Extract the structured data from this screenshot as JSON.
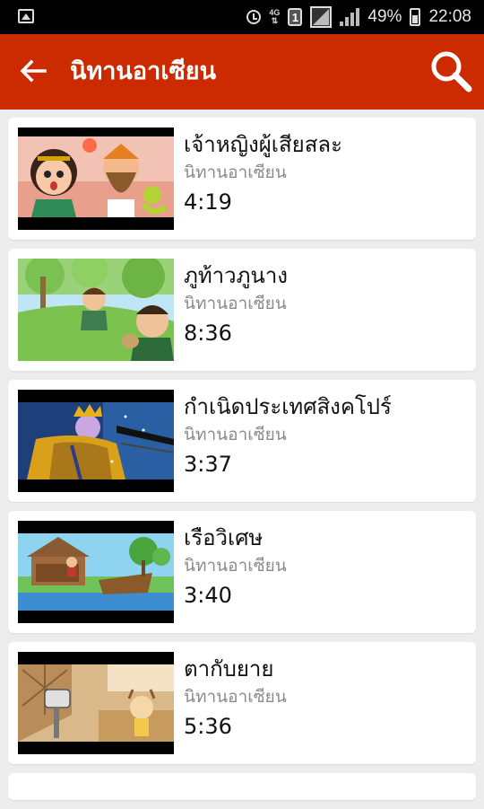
{
  "status_bar": {
    "battery_percent": "49%",
    "time": "22:08",
    "network_label": "4G",
    "sim_label": "1",
    "icons": [
      "image-icon",
      "alarm-icon",
      "network-4g-icon",
      "sim-icon",
      "signal-icon",
      "signal-bars-icon",
      "battery-icon"
    ]
  },
  "app_bar": {
    "title": "นิทานอาเซียน",
    "back_icon": "arrow-left-icon",
    "search_icon": "search-icon",
    "color": "#cc2a00"
  },
  "videos": [
    {
      "title": "เจ้าหญิงผู้เสียสละ",
      "channel": "นิทานอาเซียน",
      "duration": "4:19"
    },
    {
      "title": "ภูท้าวภูนาง",
      "channel": "นิทานอาเซียน",
      "duration": "8:36"
    },
    {
      "title": "กำเนิดประเทศสิงคโปร์",
      "channel": "นิทานอาเซียน",
      "duration": "3:37"
    },
    {
      "title": "เรือวิเศษ",
      "channel": "นิทานอาเซียน",
      "duration": "3:40"
    },
    {
      "title": "ตากับยาย",
      "channel": "นิทานอาเซียน",
      "duration": "5:36"
    }
  ]
}
